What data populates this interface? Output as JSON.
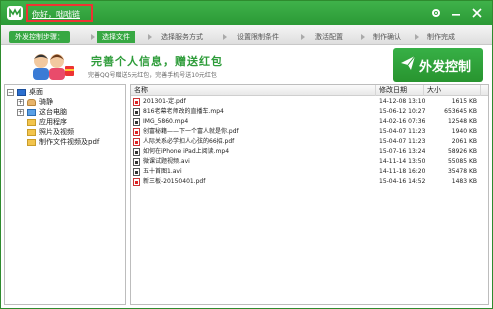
{
  "titlebar": {
    "greeting": "你好，咄咄链",
    "settings_icon": "gear-icon",
    "minimize_icon": "minimize-icon",
    "close_icon": "close-icon",
    "bg_color": "#2b9a36"
  },
  "steps": {
    "prefix": "外发控制步骤：",
    "items": [
      {
        "label": "选择文件",
        "active": true
      },
      {
        "label": "选择服务方式",
        "active": false
      },
      {
        "label": "设置限制条件",
        "active": false
      },
      {
        "label": "激活配置",
        "active": false
      },
      {
        "label": "制作确认",
        "active": false
      },
      {
        "label": "制作完成",
        "active": false
      }
    ]
  },
  "banner": {
    "title": "完善个人信息，赠送红包",
    "subtitle": "完善QQ号赠送5元红包，完善手机号送10元红包",
    "button_label": "外发控制",
    "accent": "#2e9c3a"
  },
  "tree": {
    "root": "桌面",
    "items": [
      {
        "label": "骑静",
        "icon": "user-folder-icon"
      },
      {
        "label": "这台电脑",
        "icon": "computer-icon"
      },
      {
        "label": "应用程序",
        "icon": "folder-icon"
      },
      {
        "label": "照片及视频",
        "icon": "folder-icon"
      },
      {
        "label": "制作文件视频及pdf",
        "icon": "folder-icon"
      }
    ]
  },
  "list": {
    "columns": {
      "name": "名称",
      "modified": "修改日期",
      "size": "大小"
    },
    "rows": [
      {
        "name": "201301-定.pdf",
        "type": "pdf",
        "modified": "14-12-08 13:10",
        "size": "1615 KB"
      },
      {
        "name": "816老幕老师改的直播车.mp4",
        "type": "video",
        "modified": "15-06-12 10:27",
        "size": "653645 KB"
      },
      {
        "name": "IMG_5860.mp4",
        "type": "video",
        "modified": "14-02-16 07:36",
        "size": "12548 KB"
      },
      {
        "name": "创富秘籍——下一个富人就是你.pdf",
        "type": "pdf",
        "modified": "15-04-07 11:23",
        "size": "1940 KB"
      },
      {
        "name": "人际关系必学扣人心弦的66招.pdf",
        "type": "pdf",
        "modified": "15-04-07 11:23",
        "size": "2061 KB"
      },
      {
        "name": "如何在iPhone iPad上阅读.mp4",
        "type": "video",
        "modified": "15-07-16 13:24",
        "size": "58926 KB"
      },
      {
        "name": "微课试题视频.avi",
        "type": "video",
        "modified": "14-11-14 13:50",
        "size": "55085 KB"
      },
      {
        "name": "五十首图1.avi",
        "type": "video",
        "modified": "14-11-18 16:20",
        "size": "35478 KB"
      },
      {
        "name": "新三板-20150401.pdf",
        "type": "pdf",
        "modified": "15-04-16 14:52",
        "size": "1483 KB"
      }
    ]
  }
}
